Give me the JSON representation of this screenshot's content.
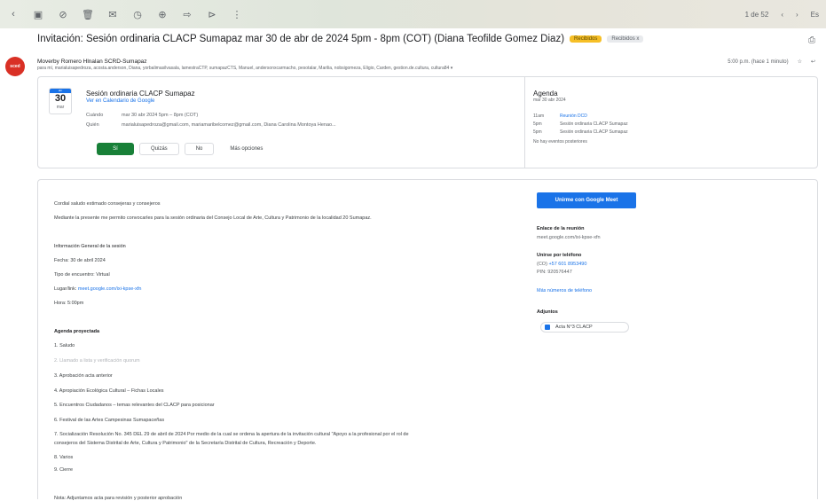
{
  "toolbar": {
    "right_text": "1 de 52",
    "right_label": "Es"
  },
  "email": {
    "subject": "Invitación: Sesión ordinaria CLACP Sumapaz mar 30 de abr de 2024 5pm - 8pm (COT) (Diana Teofilde Gomez Diaz)",
    "label1": "Recibidos",
    "label2": "Recibidos x",
    "sender": "Moverby Romero Hlnalan SCRD-Sumapaz",
    "recipients": "para mí, marialuisapedroza, acosta.anderson, Diana, yorbalimasilvasala, lamestraCTP, sumapazCTS, Manuel, andersonxcarmacho, pesotalar, Marilia, nobsigomeza, Eligio, Carden, gestion.de.cultura, cultura84 ▾",
    "time": "5:00 p.m. (hace 1 minuto)",
    "avatar_text": "sced"
  },
  "invite": {
    "month_abbr": "abr",
    "day": "30",
    "weekday": "mar",
    "title": "Sesión ordinaria CLACP Sumapaz",
    "calendar_link": "Ver en Calendario de Google",
    "when_label": "Cuándo",
    "when_value": "mar 30 abr 2024 5pm – 8pm (COT)",
    "who_label": "Quién",
    "who_value": "marialuisapedroza@gmail.com, mariamaribelcomez@gmail.com, Diana Carolina Montoya Henao...",
    "yes": "Sí",
    "maybe": "Quizás",
    "no": "No",
    "more": "Más opciones",
    "agenda_title": "Agenda",
    "agenda_date": "mar 30 abr 2024",
    "agenda": [
      {
        "time": "11am",
        "text": "Reunión DCD",
        "link": true
      },
      {
        "time": "5pm",
        "text": "Sesión ordinaria CLACP Sumapaz",
        "link": false
      },
      {
        "time": "5pm",
        "text": "Sesión ordinaria CLACP Sumapaz",
        "link": false
      }
    ],
    "no_more": "No hay eventos posteriores"
  },
  "body": {
    "greeting": "Cordial saludo estimado consejeras y consejeros",
    "intro": "Mediante la presente me permito convocarles para la sesión ordinaria del Consejo Local de Arte, Cultura y Patrimonio de la localidad 20 Sumapaz.",
    "info_title": "Información General de la sesión",
    "date_line": "Fecha: 30 de abril 2024",
    "type_line": "Tipo de encuentro: Virtual",
    "place_prefix": "Lugar/link: ",
    "place_link": "meet.google.com/ixi-kpse-xfn",
    "time_line": "Hora: 5:00pm",
    "agenda_title": "Agenda proyectada",
    "items": [
      "1. Saludo",
      "2. Llamado a lista y verificación quorum",
      "3. Aprobación acta anterior",
      "4. Apropiación Ecológica Cultural – Fichas Locales",
      "5. Encuentros Ciudadanos – temas relevantes del CLACP para posicionar",
      "6. Festival de las Artes Campesinas Sumapaceñas",
      "7. Socialización Resolución No. 345 DEL 29 de abril de 2024 Por medio de la cual se ordena la apertura de la invitación cultural \"Apoyo a la profesional por el rol de",
      "consejeros del Sistema Distrital de Arte, Cultura y Patrimonio\" de la Secretaría Distrital de Cultura, Recreación y Deporte.",
      "8. Varios",
      "9. Cierre"
    ],
    "note": "Nota: Adjuntamos acta para revisión y posterior aprobación"
  },
  "side": {
    "meet_button": "Unirme con Google Meet",
    "link_title": "Enlace de la reunión",
    "link_value": "meet.google.com/ixi-kpse-xfn",
    "phone_title": "Unirse por teléfono",
    "phone_prefix": "(CO) ",
    "phone_number": "+57 601 8953490",
    "pin": "PIN: 920576447",
    "more_phones": "Más números de teléfono",
    "attach_title": "Adjuntos",
    "attach_name": "Acta N°3 CLACP"
  }
}
